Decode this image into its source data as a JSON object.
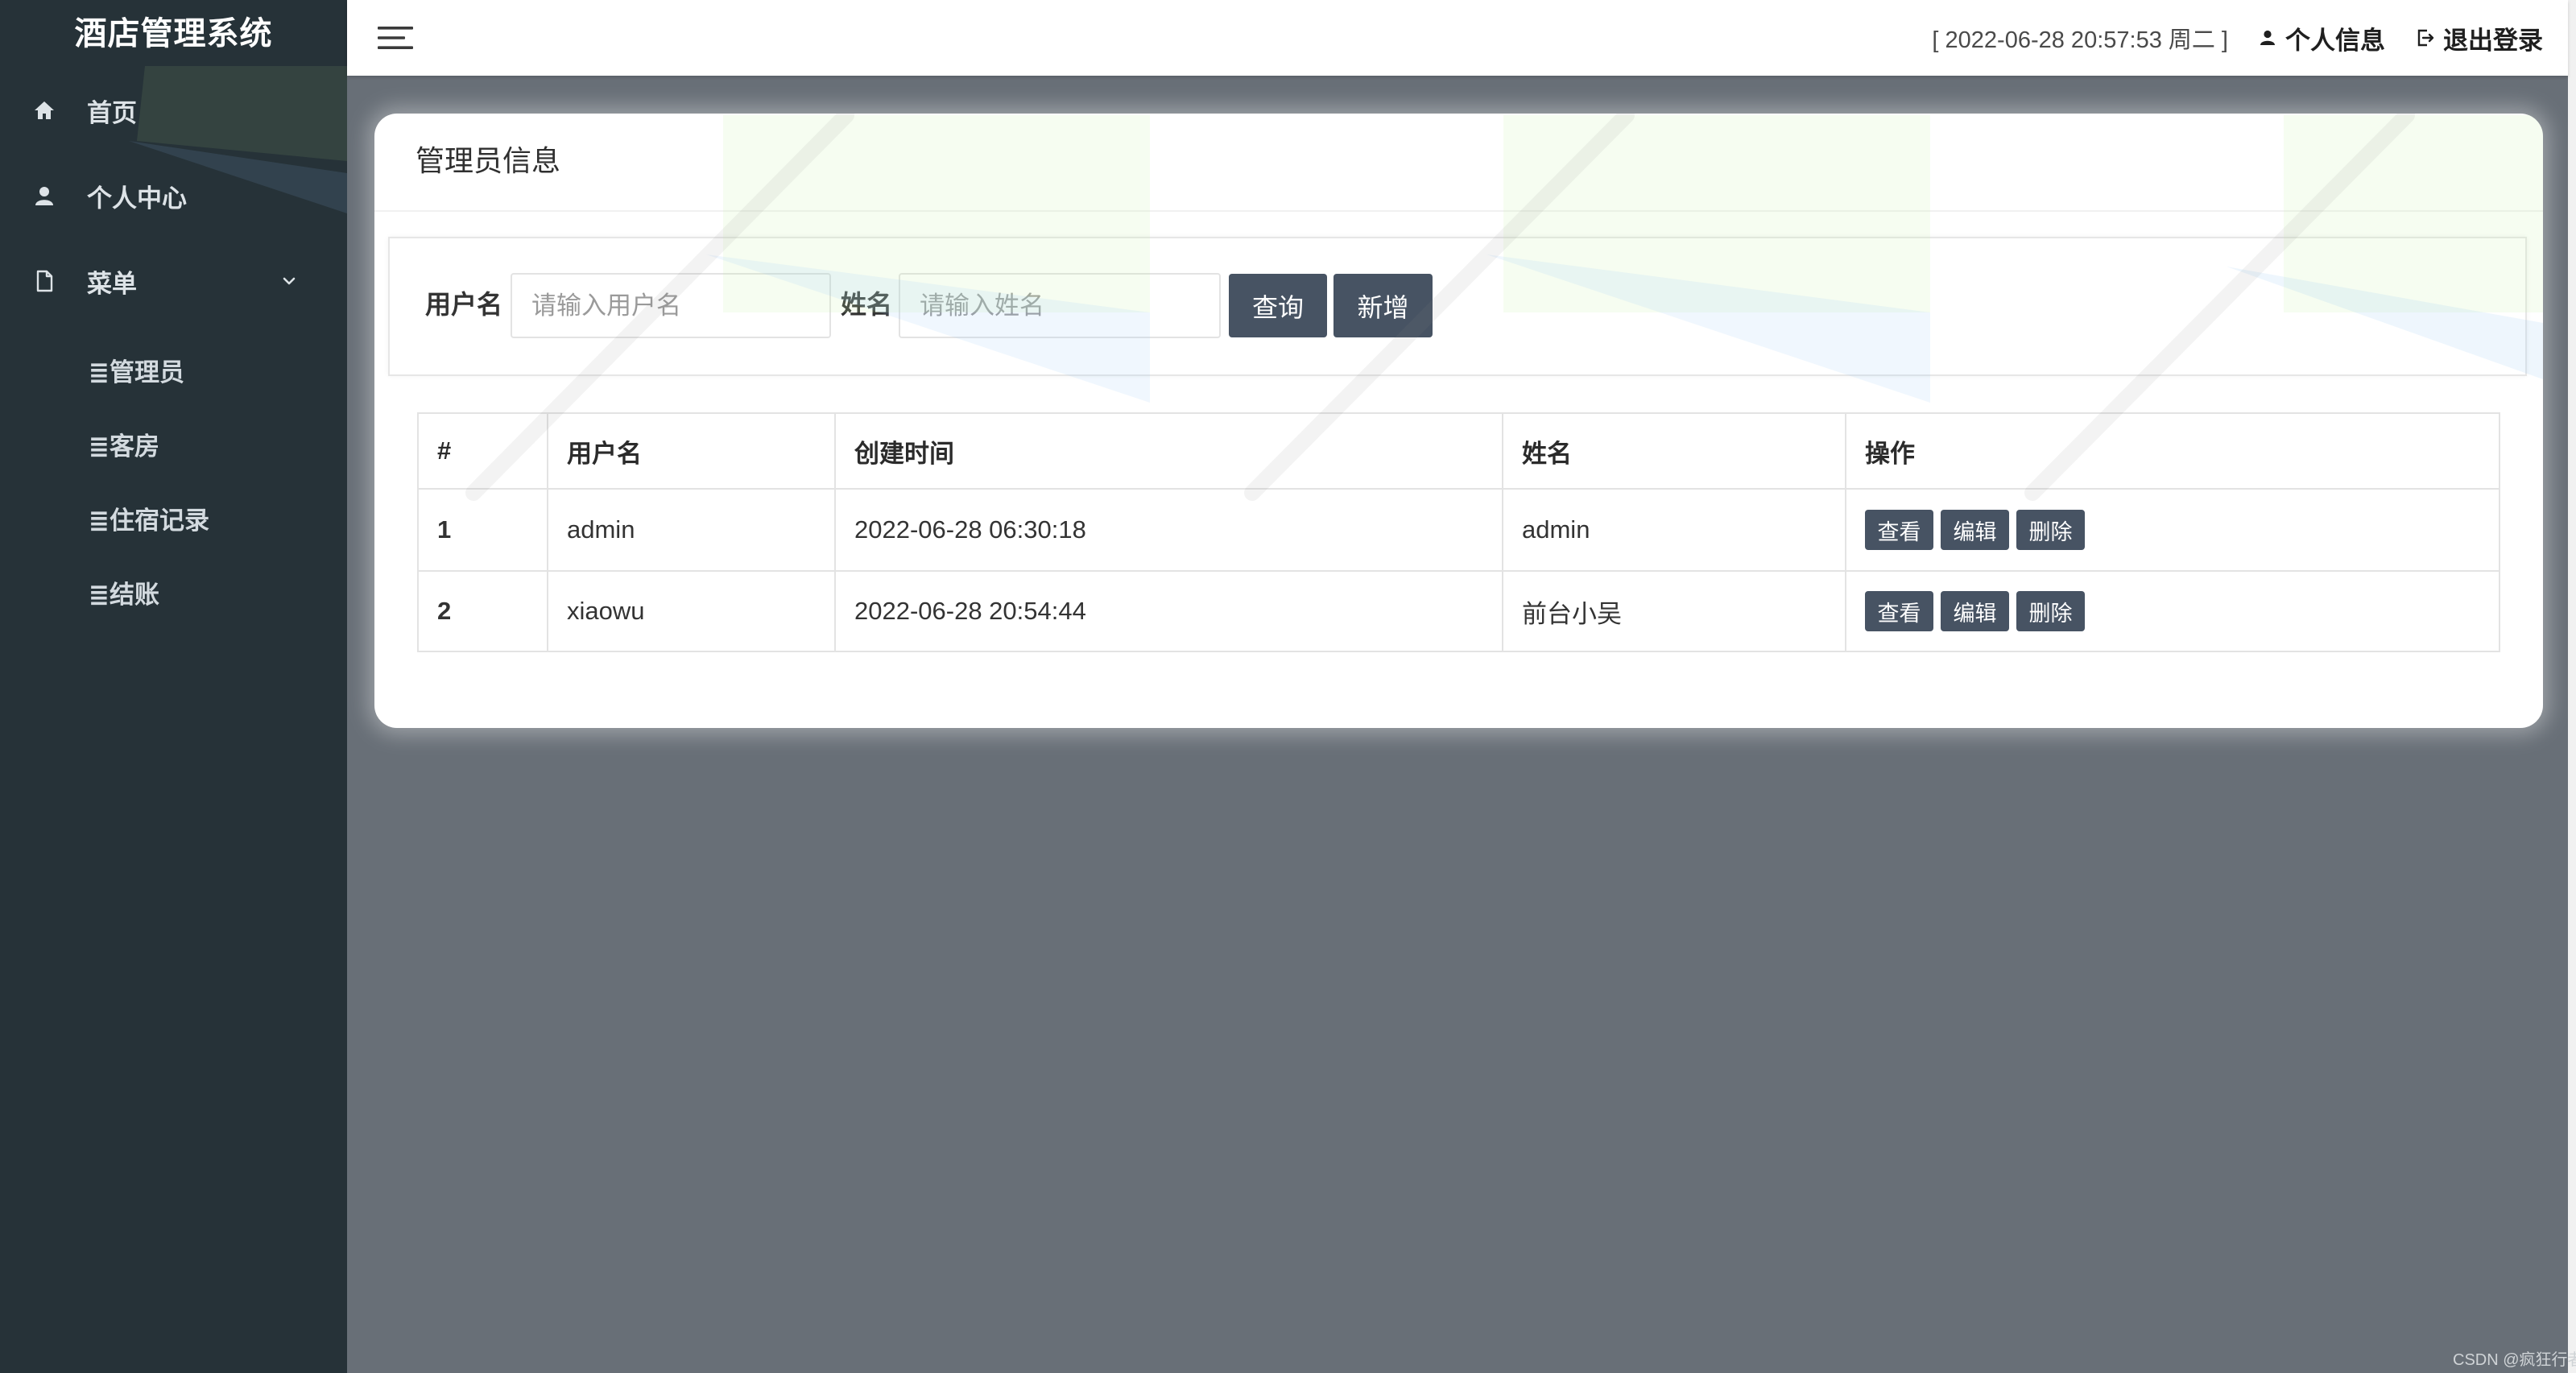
{
  "app": {
    "title": "酒店管理系统"
  },
  "colors": {
    "sidebar_bg": "#263238",
    "main_bg": "#686f77",
    "header_bg": "#ffffff",
    "button_bg": "#475363",
    "card_bg": "#ffffff"
  },
  "sidebar": {
    "items": [
      {
        "label": "首页",
        "icon": "home-icon"
      },
      {
        "label": "个人中心",
        "icon": "user-icon"
      },
      {
        "label": "菜单",
        "icon": "file-icon",
        "expanded": true
      }
    ],
    "submenu": [
      {
        "label": "≣管理员"
      },
      {
        "label": "≣客房"
      },
      {
        "label": "≣住宿记录"
      },
      {
        "label": "≣结账"
      }
    ]
  },
  "header": {
    "menu_icon": "hamburger-icon",
    "datetime": "[ 2022-06-28 20:57:53 周二 ]",
    "profile_icon": "user-icon",
    "profile_label": "个人信息",
    "logout_icon": "logout-icon",
    "logout_label": "退出登录"
  },
  "card": {
    "title": "管理员信息"
  },
  "search": {
    "username_label": "用户名",
    "username_placeholder": "请输入用户名",
    "name_label": "姓名",
    "name_placeholder": "请输入姓名",
    "query_label": "查询",
    "add_label": "新增"
  },
  "table": {
    "columns": [
      "#",
      "用户名",
      "创建时间",
      "姓名",
      "操作"
    ],
    "rows": [
      {
        "index": "1",
        "username": "admin",
        "created": "2022-06-28 06:30:18",
        "name": "admin"
      },
      {
        "index": "2",
        "username": "xiaowu",
        "created": "2022-06-28 20:54:44",
        "name": "前台小吴"
      }
    ],
    "actions": [
      "查看",
      "编辑",
      "删除"
    ]
  },
  "watermark": "CSDN @疯狂行者"
}
